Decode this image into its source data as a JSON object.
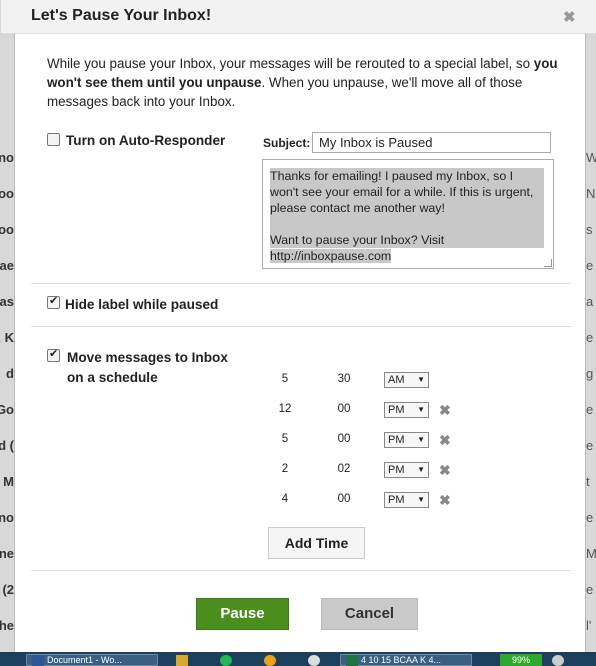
{
  "dialog": {
    "title": "Let's Pause Your Inbox!",
    "close_glyph": "✖",
    "intro_part1": "While you pause your Inbox, your messages will be rerouted to a special label, so ",
    "intro_bold": "you won't see them until you unpause",
    "intro_part2": ". When you unpause, we'll move all of those messages back into your Inbox."
  },
  "auto_responder": {
    "label": "Turn on Auto-Responder",
    "checked": false,
    "subject_label": "Subject:",
    "subject_value": "My Inbox is Paused",
    "message_line1": "Thanks for emailing! I paused my Inbox, so I won't see your email for a while. If this is urgent, please contact me another way!",
    "message_line2": "Want to pause your Inbox? Visit",
    "message_line3": "http://inboxpause.com"
  },
  "hide_label": {
    "label": "Hide label while paused",
    "checked": true
  },
  "schedule": {
    "label_line1": "Move messages to Inbox",
    "label_line2": "on a schedule",
    "checked": true,
    "times": [
      {
        "hour": "5",
        "minute": "30",
        "ampm": "AM",
        "removable": false
      },
      {
        "hour": "12",
        "minute": "00",
        "ampm": "PM",
        "removable": true
      },
      {
        "hour": "5",
        "minute": "00",
        "ampm": "PM",
        "removable": true
      },
      {
        "hour": "2",
        "minute": "02",
        "ampm": "PM",
        "removable": true
      },
      {
        "hour": "4",
        "minute": "00",
        "ampm": "PM",
        "removable": true
      }
    ],
    "add_time_label": "Add Time",
    "remove_glyph": "✖"
  },
  "buttons": {
    "pause_label": "Pause",
    "cancel_label": "Cancel"
  },
  "background": {
    "left_fragments": [
      "ano",
      "loo",
      "loo",
      "ae",
      "Cas",
      ", K",
      "d",
      "Go",
      "d (",
      "M",
      "ano",
      "ne",
      "(2",
      "phe"
    ],
    "right_fragments": [
      "Wed",
      "N",
      "s",
      "e",
      "a",
      "e",
      "g",
      "e",
      "e",
      "t",
      "e",
      "MI",
      "e",
      "l'"
    ]
  },
  "taskbar": {
    "word_task": "Document1 - Wo...",
    "excel_task": "4 10 15 BCAA K 4...",
    "battery": "99%"
  },
  "colors": {
    "pause_green": "#4a8f1d",
    "cancel_gray": "#c9c9c9",
    "taskbar_blue": "#1d3f5e"
  }
}
